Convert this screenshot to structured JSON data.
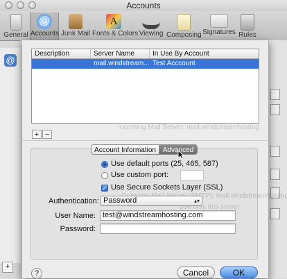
{
  "window": {
    "title": "Accounts"
  },
  "toolbar": {
    "items": [
      {
        "label": "General",
        "icon": "switch-icon"
      },
      {
        "label": "Accounts",
        "icon": "at-sign-icon"
      },
      {
        "label": "Junk Mail",
        "icon": "junk-mail-icon"
      },
      {
        "label": "Fonts & Colors",
        "icon": "fonts-colors-icon"
      },
      {
        "label": "Viewing",
        "icon": "glasses-icon"
      },
      {
        "label": "Composing",
        "icon": "pencil-icon"
      },
      {
        "label": "Signatures",
        "icon": "signature-icon"
      },
      {
        "label": "Rules",
        "icon": "rules-icon"
      }
    ],
    "active": "Accounts"
  },
  "smtp_table": {
    "columns": [
      "Description",
      "Server Name",
      "In Use By Account"
    ],
    "rows": [
      {
        "description": "",
        "server": "mail.windstream...",
        "account": "Test Acccount",
        "selected": true
      }
    ]
  },
  "table_buttons": {
    "add": "+",
    "remove": "−"
  },
  "tabs": {
    "info": "Account Information",
    "advanced": "Advanced",
    "active": "Advanced"
  },
  "ports": {
    "default_label": "Use default ports (25, 465, 587)",
    "custom_label": "Use custom port:",
    "selected": "default"
  },
  "ssl": {
    "label": "Use Secure Sockets Layer (SSL)",
    "checked": true
  },
  "auth": {
    "label": "Authentication:",
    "value": "Password"
  },
  "user": {
    "label": "User Name:",
    "value": "test@windstreamhosting.com"
  },
  "password": {
    "label": "Password:",
    "value": ""
  },
  "background_text": {
    "line1": "Incoming Mail Server: mail.windstreamhosting",
    "line2": "Outgoing Mail Server (SMTP): mail.windstreamhosting",
    "line3": "Use only this server"
  },
  "footer": {
    "help": "?",
    "cancel": "Cancel",
    "ok": "OK"
  },
  "colors": {
    "selection": "#3875d7",
    "default_button": "#4b8fe6"
  }
}
